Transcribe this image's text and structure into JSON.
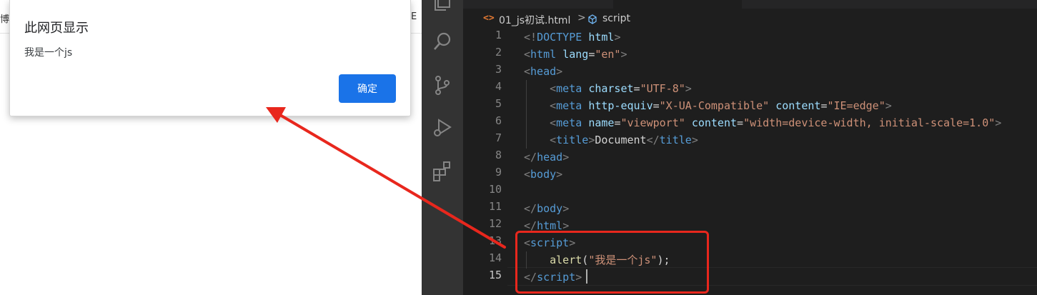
{
  "browser": {
    "strip_left_char": "博",
    "strip_right_char": "E",
    "dialog": {
      "title": "此网页显示",
      "message": "我是一个js",
      "ok_label": "确定"
    }
  },
  "editor": {
    "breadcrumb": {
      "file": "01_js初试.html",
      "separator": ">",
      "symbol": "script"
    },
    "line_numbers": [
      "1",
      "2",
      "3",
      "4",
      "5",
      "6",
      "7",
      "8",
      "9",
      "10",
      "11",
      "12",
      "13",
      "14",
      "15"
    ],
    "current_line": "15",
    "code": {
      "l1": {
        "open": "<!",
        "kw": "DOCTYPE",
        "sp": " ",
        "name": "html",
        "close": ">"
      },
      "l2": {
        "open": "<",
        "tag": "html",
        "sp": " ",
        "attr": "lang",
        "eq": "=",
        "val": "\"en\"",
        "close": ">"
      },
      "l3": {
        "open": "<",
        "tag": "head",
        "close": ">"
      },
      "l4": {
        "indent": "    ",
        "open": "<",
        "tag": "meta",
        "sp": " ",
        "attr": "charset",
        "eq": "=",
        "val": "\"UTF-8\"",
        "close": ">"
      },
      "l5": {
        "indent": "    ",
        "open": "<",
        "tag": "meta",
        "sp": " ",
        "attr1": "http-equiv",
        "eq1": "=",
        "val1": "\"X-UA-Compatible\"",
        "sp2": " ",
        "attr2": "content",
        "eq2": "=",
        "val2": "\"IE=edge\"",
        "close": ">"
      },
      "l6": {
        "indent": "    ",
        "open": "<",
        "tag": "meta",
        "sp": " ",
        "attr1": "name",
        "eq1": "=",
        "val1": "\"viewport\"",
        "sp2": " ",
        "attr2": "content",
        "eq2": "=",
        "val2": "\"width=device-width, initial-scale=1.0\"",
        "close": ">"
      },
      "l7": {
        "indent": "    ",
        "open": "<",
        "tag": "title",
        "close": ">",
        "text": "Document",
        "open2": "</",
        "tag2": "title",
        "close2": ">"
      },
      "l8": {
        "open": "</",
        "tag": "head",
        "close": ">"
      },
      "l9": {
        "open": "<",
        "tag": "body",
        "close": ">"
      },
      "l11": {
        "open": "</",
        "tag": "body",
        "close": ">"
      },
      "l12": {
        "open": "</",
        "tag": "html",
        "close": ">"
      },
      "l13": {
        "open": "<",
        "tag": "script",
        "close": ">"
      },
      "l14": {
        "indent": "    ",
        "fn": "alert",
        "paren_open": "(",
        "str": "\"我是一个js\"",
        "paren_close": ");"
      },
      "l15": {
        "open": "</",
        "tag": "script",
        "close": ">"
      }
    }
  },
  "colors": {
    "dialog_button": "#1a73e8",
    "editor_bg": "#1e1e1e",
    "activity_bar": "#333333",
    "tag": "#569cd6",
    "attribute": "#9cdcfe",
    "string": "#ce9178",
    "function": "#dcdcaa",
    "annotation_red": "#e8271d"
  },
  "icons": [
    "explorer-icon",
    "search-icon",
    "source-control-icon",
    "run-debug-icon",
    "extensions-icon",
    "html-file-icon",
    "script-symbol-icon"
  ]
}
